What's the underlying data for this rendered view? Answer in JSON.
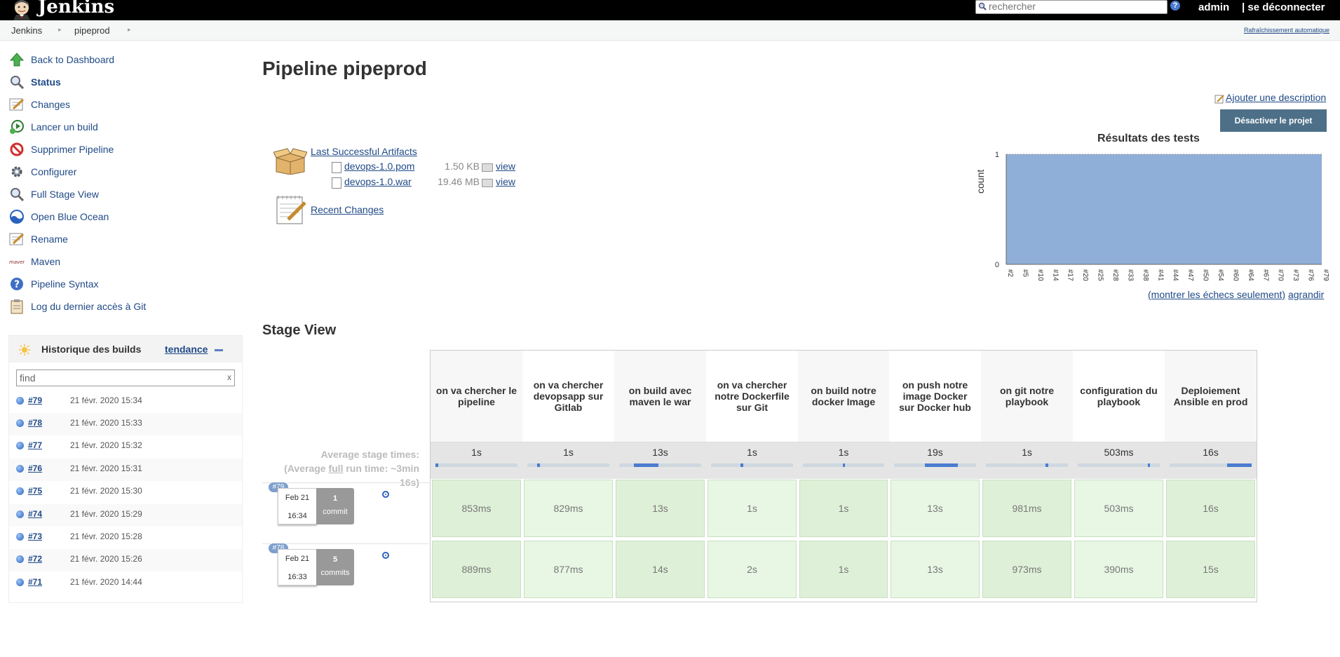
{
  "header": {
    "app_name": "Jenkins",
    "search_placeholder": "rechercher",
    "help": "?",
    "user": "admin",
    "logout": "| se déconnecter"
  },
  "breadcrumb": {
    "items": [
      "Jenkins",
      "pipeprod"
    ],
    "auto_refresh": "Rafraîchissement automatique"
  },
  "sidebar": {
    "items": [
      {
        "label": "Back to Dashboard",
        "icon": "up-arrow-icon"
      },
      {
        "label": "Status",
        "icon": "magnifier-icon"
      },
      {
        "label": "Changes",
        "icon": "notepad-icon"
      },
      {
        "label": "Lancer un build",
        "icon": "clock-play-icon"
      },
      {
        "label": "Supprimer Pipeline",
        "icon": "no-entry-icon"
      },
      {
        "label": "Configurer",
        "icon": "gear-icon"
      },
      {
        "label": "Full Stage View",
        "icon": "magnifier-icon"
      },
      {
        "label": "Open Blue Ocean",
        "icon": "blue-ocean-icon"
      },
      {
        "label": "Rename",
        "icon": "notepad-icon"
      },
      {
        "label": "Maven",
        "icon": "maven-icon"
      },
      {
        "label": "Pipeline Syntax",
        "icon": "help-icon"
      },
      {
        "label": "Log du dernier accès à Git",
        "icon": "clipboard-icon"
      }
    ]
  },
  "history": {
    "title": "Historique des builds",
    "trend": "tendance",
    "filter_placeholder": "find",
    "clear": "x",
    "builds": [
      {
        "num": "#79",
        "date": "21 févr. 2020 15:34"
      },
      {
        "num": "#78",
        "date": "21 févr. 2020 15:33"
      },
      {
        "num": "#77",
        "date": "21 févr. 2020 15:32"
      },
      {
        "num": "#76",
        "date": "21 févr. 2020 15:31"
      },
      {
        "num": "#75",
        "date": "21 févr. 2020 15:30"
      },
      {
        "num": "#74",
        "date": "21 févr. 2020 15:29"
      },
      {
        "num": "#73",
        "date": "21 févr. 2020 15:28"
      },
      {
        "num": "#72",
        "date": "21 févr. 2020 15:26"
      },
      {
        "num": "#71",
        "date": "21 févr. 2020 14:44"
      }
    ]
  },
  "main": {
    "title": "Pipeline pipeprod",
    "add_description": "Ajouter une description",
    "disable_project": "Désactiver le projet",
    "last_successful_artifacts": "Last Successful Artifacts",
    "artifacts": [
      {
        "name": "devops-1.0.pom",
        "size": "1.50 KB",
        "view": "view"
      },
      {
        "name": "devops-1.0.war",
        "size": "19.46 MB",
        "view": "view"
      }
    ],
    "recent_changes": "Recent Changes"
  },
  "chart_data": {
    "type": "area",
    "title": "Résultats des tests",
    "ylabel": "count",
    "xlabel": "",
    "ylim": [
      0,
      1
    ],
    "yticks": [
      "1",
      "0"
    ],
    "x": [
      "#2",
      "#5",
      "#10",
      "#14",
      "#17",
      "#20",
      "#25",
      "#28",
      "#33",
      "#38",
      "#41",
      "#44",
      "#47",
      "#50",
      "#54",
      "#60",
      "#64",
      "#67",
      "#70",
      "#73",
      "#76",
      "#79"
    ],
    "series": [
      {
        "values": [
          1,
          1,
          1,
          1,
          1,
          1,
          1,
          1,
          1,
          1,
          1,
          1,
          1,
          1,
          1,
          1,
          1,
          1,
          1,
          1,
          1,
          1
        ],
        "color": "#8fafd8"
      }
    ],
    "link_failures": "(montrer les échecs seulement)",
    "link_enlarge": "agrandir"
  },
  "stage_view": {
    "title": "Stage View",
    "avg_label_1": "Average stage times:",
    "avg_label_2a": "(Average ",
    "avg_label_2b": "full",
    "avg_label_2c": " run time: ~3min",
    "avg_label_3": "16s)",
    "stages": [
      {
        "name": "on va chercher le pipeline",
        "avg": "1s",
        "progress": 0.03
      },
      {
        "name": "on va chercher devopsapp sur Gitlab",
        "avg": "1s",
        "progress": 0.03
      },
      {
        "name": "on build avec maven le war",
        "avg": "13s",
        "progress": 0.3
      },
      {
        "name": "on va chercher notre Dockerfile sur Git",
        "avg": "1s",
        "progress": 0.03
      },
      {
        "name": "on build notre docker Image",
        "avg": "1s",
        "progress": 0.03
      },
      {
        "name": "on push notre image Docker sur Docker hub",
        "avg": "19s",
        "progress": 0.4
      },
      {
        "name": "on git notre playbook",
        "avg": "1s",
        "progress": 0.03
      },
      {
        "name": "configuration du playbook",
        "avg": "503ms",
        "progress": 0.02
      },
      {
        "name": "Deploiement Ansible en prod",
        "avg": "16s",
        "progress": 0.3
      }
    ],
    "runs": [
      {
        "badge": "#79",
        "date": "Feb 21",
        "time": "16:34",
        "commits_count": "1",
        "commits_word": "commit",
        "durations": [
          "853ms",
          "829ms",
          "13s",
          "1s",
          "1s",
          "13s",
          "981ms",
          "503ms",
          "16s"
        ]
      },
      {
        "badge": "#78",
        "date": "Feb 21",
        "time": "16:33",
        "commits_count": "5",
        "commits_word": "commits",
        "durations": [
          "889ms",
          "877ms",
          "14s",
          "2s",
          "1s",
          "13s",
          "973ms",
          "390ms",
          "15s"
        ]
      }
    ]
  }
}
